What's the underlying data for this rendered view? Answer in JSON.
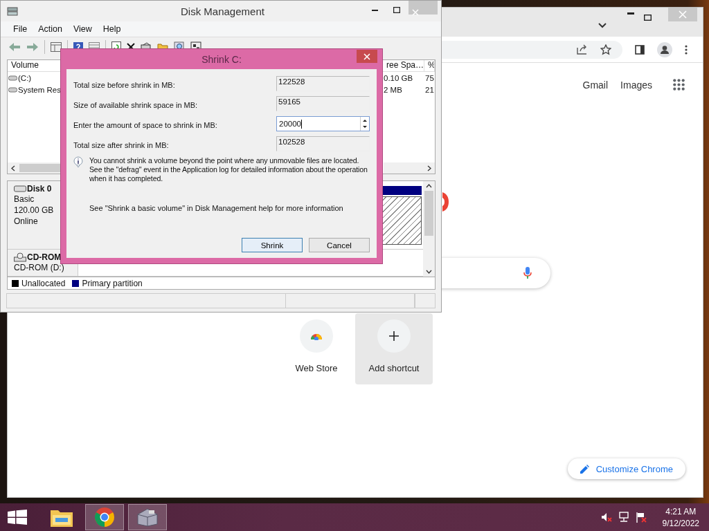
{
  "browser": {
    "links": [
      "Gmail",
      "Images"
    ],
    "shortcuts": [
      {
        "kind": "store",
        "label": "Web Store"
      },
      {
        "kind": "add",
        "label": "Add shortcut"
      }
    ],
    "customize": "Customize Chrome"
  },
  "disk_management": {
    "title": "Disk Management",
    "menu": [
      "File",
      "Action",
      "View",
      "Help"
    ],
    "volume_list": {
      "columns": [
        "Volume",
        "ree Spa…",
        "%"
      ],
      "rows": [
        {
          "kind": "drive",
          "cells": [
            "(C:)",
            "0.10 GB",
            "75"
          ]
        },
        {
          "kind": "drive",
          "cells": [
            "System Res",
            "2 MB",
            "21"
          ]
        }
      ]
    },
    "disks": [
      {
        "kind": "disk",
        "name": "Disk 0",
        "lines": [
          "Basic",
          "120.00 GB",
          "Online"
        ]
      },
      {
        "kind": "cdrom",
        "name": "CD-ROM",
        "lines": [
          "CD-ROM (D:)"
        ]
      }
    ],
    "legend": [
      {
        "label": "Unallocated",
        "color": "#000000"
      },
      {
        "label": "Primary partition",
        "color": "#000080"
      }
    ]
  },
  "dialog": {
    "title": "Shrink C:",
    "fields": [
      {
        "kind": "readonly",
        "label": "Total size before shrink in MB:",
        "value": "122528"
      },
      {
        "kind": "readonly",
        "label": "Size of available shrink space in MB:",
        "value": "59165"
      },
      {
        "kind": "spin",
        "label": "Enter the amount of space to shrink in MB:",
        "value": "20000"
      },
      {
        "kind": "readonly",
        "label": "Total size after shrink in MB:",
        "value": "102528"
      }
    ],
    "info": "You cannot shrink a volume beyond the point where any unmovable files are located. See the \"defrag\" event in the Application log for detailed information about the operation when it has completed.",
    "help_note": "See \"Shrink a basic volume\" in Disk Management help for more information",
    "buttons": [
      {
        "label": "Shrink",
        "default": true
      },
      {
        "label": "Cancel",
        "default": false
      }
    ]
  },
  "taskbar": {
    "apps": [
      {
        "kind": "explorer",
        "running": false
      },
      {
        "kind": "chrome",
        "running": true
      },
      {
        "kind": "disk",
        "running": true
      }
    ],
    "time": "4:21 AM",
    "date": "9/12/2022"
  }
}
